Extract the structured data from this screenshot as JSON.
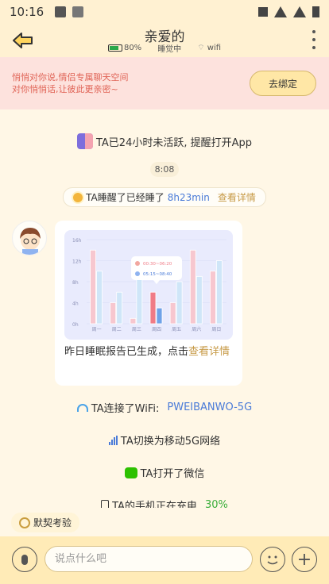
{
  "status_bar": {
    "time": "10:16"
  },
  "header": {
    "title": "亲爱的",
    "battery": "80%",
    "state": "睡觉中",
    "network": "wifi"
  },
  "bind_banner": {
    "line1": "悄悄对你说,情侣专属聊天空间",
    "line2": "对你悄悄话,让彼此更亲密~",
    "button": "去绑定"
  },
  "messages": {
    "inactive": "TA已24小时未活跃, 提醒打开App",
    "time": "8:08",
    "sleep_prefix": "TA睡醒了已经睡了",
    "sleep_duration": "8h23min",
    "sleep_link": "查看详情",
    "report_text": "昨日睡眠报告已生成，点击",
    "report_link": "查看详情",
    "wifi_prefix": "TA连接了WiFi:",
    "wifi_name": "PWEIBANWO-5G",
    "network_switch": "TA切换为移动5G网络",
    "wechat": "TA打开了微信",
    "charging_prefix": "TA的手机正在充电",
    "charging_value": "30%"
  },
  "chart_data": {
    "type": "bar",
    "title": "",
    "categories": [
      "周一",
      "周二",
      "周三",
      "周四",
      "周五",
      "周六",
      "周日"
    ],
    "y_ticks": [
      "0h",
      "4h",
      "8h",
      "12h",
      "16h"
    ],
    "ylim": [
      0,
      16
    ],
    "series": [
      {
        "name": "",
        "values": [
          14,
          4,
          1,
          6,
          4,
          14,
          10
        ]
      },
      {
        "name": "",
        "values": [
          10,
          6,
          9,
          3,
          8,
          9,
          12
        ]
      }
    ],
    "tooltip": {
      "time1": "00:30~06:20",
      "time2": "05:15~08:40"
    },
    "colors": {
      "primary": "#F7C7CF",
      "secondary": "#CFE6F8",
      "highlight1": "#F07B86",
      "highlight2": "#6FA2E8"
    }
  },
  "bottom": {
    "tacit_label": "默契考验",
    "input_placeholder": "说点什么吧"
  }
}
